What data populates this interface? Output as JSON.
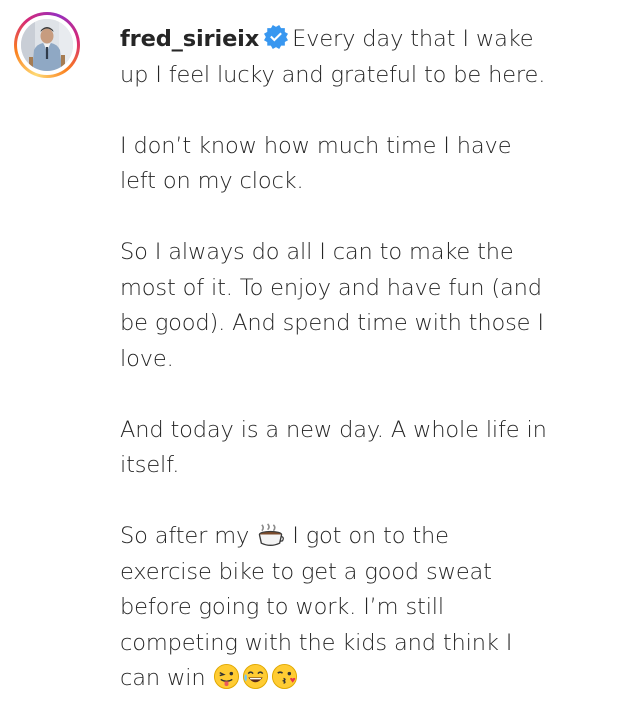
{
  "post": {
    "username": "fred_sirieix",
    "verified_icon": "verified-badge-icon",
    "colors": {
      "text": "#262626",
      "verified_blue": "#3897f0",
      "ring_start": "#feda75",
      "ring_mid": "#d62976",
      "ring_end": "#962fbf"
    },
    "caption": {
      "p1_line1": "Every day that I wake",
      "p1_line2": "up I feel lucky and grateful to be here.",
      "p2_line1": "I don’t know how much time I have",
      "p2_line2": "left on my clock.",
      "p3_line1": "So I always do all I can to make the",
      "p3_line2": "most of it. To enjoy and have fun (and",
      "p3_line3": "be good). And spend time with those I",
      "p3_line4": "love.",
      "p4_line1": "And today is a new day. A whole life in",
      "p4_line2": "itself.",
      "p5_line1_a": "So after my",
      "p5_line1_b": "I got on to the",
      "p5_line2": "exercise bike to get a good sweat",
      "p5_line3": "before going to work. I’m still",
      "p5_line4": "competing with the kids and think I",
      "p5_line5": "can win"
    },
    "emojis": [
      "coffee-icon",
      "tongue-out-face-icon",
      "laughing-face-icon",
      "kissing-face-icon"
    ]
  }
}
